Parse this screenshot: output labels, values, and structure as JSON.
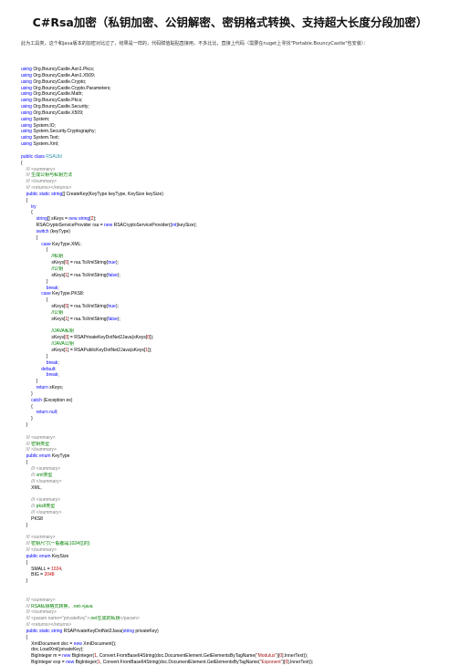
{
  "doc": {
    "title": "C#Rsa加密（私钥加密、公钥解密、密钥格式转换、支持超大长度分段加密）",
    "intro": "此为工具类，这个和java版本的加密对比过了，结果是一样的，代码赋值黏贴直接用，不多比比，直接上代码（需要在nuget上寻找\"Portable.BouncyCastle\"包安装）："
  },
  "code_lines": [
    [
      [
        "kw",
        "using"
      ],
      [
        "p",
        " Org.BouncyCastle.Asn1.Pkcs;"
      ]
    ],
    [
      [
        "kw",
        "using"
      ],
      [
        "p",
        " Org.BouncyCastle.Asn1.X509;"
      ]
    ],
    [
      [
        "kw",
        "using"
      ],
      [
        "p",
        " Org.BouncyCastle.Crypto;"
      ]
    ],
    [
      [
        "kw",
        "using"
      ],
      [
        "p",
        " Org.BouncyCastle.Crypto.Parameters;"
      ]
    ],
    [
      [
        "kw",
        "using"
      ],
      [
        "p",
        " Org.BouncyCastle.Math;"
      ]
    ],
    [
      [
        "kw",
        "using"
      ],
      [
        "p",
        " Org.BouncyCastle.Pkcs;"
      ]
    ],
    [
      [
        "kw",
        "using"
      ],
      [
        "p",
        " Org.BouncyCastle.Security;"
      ]
    ],
    [
      [
        "kw",
        "using"
      ],
      [
        "p",
        " Org.BouncyCastle.X509;"
      ]
    ],
    [
      [
        "kw",
        "using"
      ],
      [
        "p",
        " System;"
      ]
    ],
    [
      [
        "kw",
        "using"
      ],
      [
        "p",
        " System.IO;"
      ]
    ],
    [
      [
        "kw",
        "using"
      ],
      [
        "p",
        " System.Security.Cryptography;"
      ]
    ],
    [
      [
        "kw",
        "using"
      ],
      [
        "p",
        " System.Text;"
      ]
    ],
    [
      [
        "kw",
        "using"
      ],
      [
        "p",
        " System.Xml;"
      ]
    ],
    [
      [
        "p",
        ""
      ]
    ],
    [
      [
        "kw",
        "public"
      ],
      [
        "p",
        " "
      ],
      [
        "kw",
        "class"
      ],
      [
        "p",
        " "
      ],
      [
        "ty",
        "RSAUtil"
      ]
    ],
    [
      [
        "p",
        "{"
      ]
    ],
    [
      [
        "xd",
        "    /// <summary>"
      ]
    ],
    [
      [
        "xd",
        "    /// "
      ],
      [
        "cm",
        "生成公钥与私钥方法"
      ]
    ],
    [
      [
        "xd",
        "    /// </summary>"
      ]
    ],
    [
      [
        "xd",
        "    /// <returns></returns>"
      ]
    ],
    [
      [
        "p",
        "    "
      ],
      [
        "kw",
        "public"
      ],
      [
        "p",
        " "
      ],
      [
        "kw",
        "static"
      ],
      [
        "p",
        " "
      ],
      [
        "kw",
        "string"
      ],
      [
        "p",
        "[] CreateKey(KeyType keyType, KeySize keySize)"
      ]
    ],
    [
      [
        "p",
        "    {"
      ]
    ],
    [
      [
        "p",
        "        "
      ],
      [
        "kw",
        "try"
      ]
    ],
    [
      [
        "p",
        "        {"
      ]
    ],
    [
      [
        "p",
        "            "
      ],
      [
        "kw",
        "string"
      ],
      [
        "p",
        "[] sKeys = "
      ],
      [
        "kw",
        "new"
      ],
      [
        "p",
        " "
      ],
      [
        "kw",
        "string"
      ],
      [
        "p",
        "["
      ],
      [
        "nm",
        "2"
      ],
      [
        "p",
        "];"
      ]
    ],
    [
      [
        "p",
        "            RSACryptoServiceProvider rsa = "
      ],
      [
        "kw",
        "new"
      ],
      [
        "p",
        " RSACryptoServiceProvider(("
      ],
      [
        "kw",
        "int"
      ],
      [
        "p",
        ")keySize);"
      ]
    ],
    [
      [
        "p",
        "            "
      ],
      [
        "kw",
        "switch"
      ],
      [
        "p",
        " (keyType)"
      ]
    ],
    [
      [
        "p",
        "            {"
      ]
    ],
    [
      [
        "p",
        "                "
      ],
      [
        "kw",
        "case"
      ],
      [
        "p",
        " KeyType.XML:"
      ]
    ],
    [
      [
        "p",
        "                    {"
      ]
    ],
    [
      [
        "cm",
        "                        //私钥"
      ]
    ],
    [
      [
        "p",
        "                        sKeys["
      ],
      [
        "nm",
        "0"
      ],
      [
        "p",
        "] = rsa.ToXmlString("
      ],
      [
        "kw",
        "true"
      ],
      [
        "p",
        ");"
      ]
    ],
    [
      [
        "cm",
        "                        //公钥"
      ]
    ],
    [
      [
        "p",
        "                        sKeys["
      ],
      [
        "nm",
        "1"
      ],
      [
        "p",
        "] = rsa.ToXmlString("
      ],
      [
        "kw",
        "false"
      ],
      [
        "p",
        ");"
      ]
    ],
    [
      [
        "p",
        "                    }"
      ]
    ],
    [
      [
        "p",
        "                    "
      ],
      [
        "kw",
        "break"
      ],
      [
        "p",
        ";"
      ]
    ],
    [
      [
        "p",
        "                "
      ],
      [
        "kw",
        "case"
      ],
      [
        "p",
        " KeyType.PKS8:"
      ]
    ],
    [
      [
        "p",
        "                    {"
      ]
    ],
    [
      [
        "p",
        "                        sKeys["
      ],
      [
        "nm",
        "0"
      ],
      [
        "p",
        "] = rsa.ToXmlString("
      ],
      [
        "kw",
        "true"
      ],
      [
        "p",
        ");"
      ]
    ],
    [
      [
        "cm",
        "                        //公钥"
      ]
    ],
    [
      [
        "p",
        "                        sKeys["
      ],
      [
        "nm",
        "1"
      ],
      [
        "p",
        "] = rsa.ToXmlString("
      ],
      [
        "kw",
        "false"
      ],
      [
        "p",
        ");"
      ]
    ],
    [
      [
        "p",
        ""
      ]
    ],
    [
      [
        "cm",
        "                        //JAVA私钥"
      ]
    ],
    [
      [
        "p",
        "                        sKeys["
      ],
      [
        "nm",
        "0"
      ],
      [
        "p",
        "] = RSAPrivateKeyDotNet2Java(sKeys["
      ],
      [
        "nm",
        "0"
      ],
      [
        "p",
        "]);"
      ]
    ],
    [
      [
        "cm",
        "                        //JAVA公钥"
      ]
    ],
    [
      [
        "p",
        "                        sKeys["
      ],
      [
        "nm",
        "1"
      ],
      [
        "p",
        "] = RSAPublicKeyDotNet2Java(sKeys["
      ],
      [
        "nm",
        "1"
      ],
      [
        "p",
        "]);"
      ]
    ],
    [
      [
        "p",
        "                    }"
      ]
    ],
    [
      [
        "p",
        "                    "
      ],
      [
        "kw",
        "break"
      ],
      [
        "p",
        ";"
      ]
    ],
    [
      [
        "p",
        "                "
      ],
      [
        "kw",
        "default"
      ],
      [
        "p",
        ":"
      ]
    ],
    [
      [
        "p",
        "                    "
      ],
      [
        "kw",
        "break"
      ],
      [
        "p",
        ";"
      ]
    ],
    [
      [
        "p",
        "            }"
      ]
    ],
    [
      [
        "p",
        "            "
      ],
      [
        "kw",
        "return"
      ],
      [
        "p",
        " sKeys;"
      ]
    ],
    [
      [
        "p",
        "        }"
      ]
    ],
    [
      [
        "p",
        "        "
      ],
      [
        "kw",
        "catch"
      ],
      [
        "p",
        " (Exception ex)"
      ]
    ],
    [
      [
        "p",
        "        {"
      ]
    ],
    [
      [
        "p",
        "            "
      ],
      [
        "kw",
        "return"
      ],
      [
        "p",
        " "
      ],
      [
        "kw",
        "null"
      ],
      [
        "p",
        ";"
      ]
    ],
    [
      [
        "p",
        "        }"
      ]
    ],
    [
      [
        "p",
        "    }"
      ]
    ],
    [
      [
        "p",
        ""
      ]
    ],
    [
      [
        "xd",
        "    /// <summary>"
      ]
    ],
    [
      [
        "xd",
        "    /// "
      ],
      [
        "cm",
        "密钥类型"
      ]
    ],
    [
      [
        "xd",
        "    /// </summary>"
      ]
    ],
    [
      [
        "p",
        "    "
      ],
      [
        "kw",
        "public"
      ],
      [
        "p",
        " "
      ],
      [
        "kw",
        "enum"
      ],
      [
        "p",
        " KeyType"
      ]
    ],
    [
      [
        "p",
        "    {"
      ]
    ],
    [
      [
        "xd",
        "        /// <summary>"
      ]
    ],
    [
      [
        "xd",
        "        /// "
      ],
      [
        "cm",
        "xml类型"
      ]
    ],
    [
      [
        "xd",
        "        /// </summary>"
      ]
    ],
    [
      [
        "p",
        "        XML,"
      ]
    ],
    [
      [
        "p",
        ""
      ]
    ],
    [
      [
        "xd",
        "        /// <summary>"
      ]
    ],
    [
      [
        "xd",
        "        /// "
      ],
      [
        "cm",
        "pks8类型"
      ]
    ],
    [
      [
        "xd",
        "        /// </summary>"
      ]
    ],
    [
      [
        "p",
        "        PKS8"
      ]
    ],
    [
      [
        "p",
        "    }"
      ]
    ],
    [
      [
        "p",
        ""
      ]
    ],
    [
      [
        "xd",
        "    /// <summary>"
      ]
    ],
    [
      [
        "xd",
        "    /// "
      ],
      [
        "cm",
        "密钥尺寸(一般都是1024位的)"
      ]
    ],
    [
      [
        "xd",
        "    /// </summary>"
      ]
    ],
    [
      [
        "p",
        "    "
      ],
      [
        "kw",
        "public"
      ],
      [
        "p",
        " "
      ],
      [
        "kw",
        "enum"
      ],
      [
        "p",
        " KeySize"
      ]
    ],
    [
      [
        "p",
        "    {"
      ]
    ],
    [
      [
        "p",
        "        SMALL = "
      ],
      [
        "nm",
        "1024"
      ],
      [
        "p",
        ","
      ]
    ],
    [
      [
        "p",
        "        BIG = "
      ],
      [
        "nm",
        "2048"
      ]
    ],
    [
      [
        "p",
        "    }"
      ]
    ],
    [
      [
        "p",
        ""
      ]
    ],
    [
      [
        "p",
        ""
      ]
    ],
    [
      [
        "xd",
        "    /// <summary>"
      ]
    ],
    [
      [
        "xd",
        "    /// "
      ],
      [
        "cm",
        "RSA私钥格式转换，.net->java"
      ]
    ],
    [
      [
        "xd",
        "    /// </summary>"
      ]
    ],
    [
      [
        "xd",
        "    /// <param name=\"privateKey\">"
      ],
      [
        "cm",
        ".net生成的私钥"
      ],
      [
        "xd",
        "</param>"
      ]
    ],
    [
      [
        "xd",
        "    /// <returns></returns>"
      ]
    ],
    [
      [
        "p",
        "    "
      ],
      [
        "kw",
        "public"
      ],
      [
        "p",
        " "
      ],
      [
        "kw",
        "static"
      ],
      [
        "p",
        " "
      ],
      [
        "kw",
        "string"
      ],
      [
        "p",
        " RSAPrivateKeyDotNet2Java("
      ],
      [
        "kw",
        "string"
      ],
      [
        "p",
        " privateKey)"
      ]
    ],
    [
      [
        "p",
        "    {"
      ]
    ],
    [
      [
        "p",
        "        XmlDocument doc = "
      ],
      [
        "kw",
        "new"
      ],
      [
        "p",
        " XmlDocument();"
      ]
    ],
    [
      [
        "p",
        "        doc.LoadXml(privateKey);"
      ]
    ],
    [
      [
        "p",
        "        BigInteger m = "
      ],
      [
        "kw",
        "new"
      ],
      [
        "p",
        " BigInteger("
      ],
      [
        "nm",
        "1"
      ],
      [
        "p",
        ", Convert.FromBase64String(doc.DocumentElement.GetElementsByTagName("
      ],
      [
        "st",
        "\"Modulus\""
      ],
      [
        "p",
        ")["
      ],
      [
        "nm",
        "0"
      ],
      [
        "p",
        "].InnerText));"
      ]
    ],
    [
      [
        "p",
        "        BigInteger exp = "
      ],
      [
        "kw",
        "new"
      ],
      [
        "p",
        " BigInteger("
      ],
      [
        "nm",
        "1"
      ],
      [
        "p",
        ", Convert.FromBase64String(doc.DocumentElement.GetElementsByTagName("
      ],
      [
        "st",
        "\"Exponent\""
      ],
      [
        "p",
        ")["
      ],
      [
        "nm",
        "0"
      ],
      [
        "p",
        "].InnerText));"
      ]
    ]
  ]
}
